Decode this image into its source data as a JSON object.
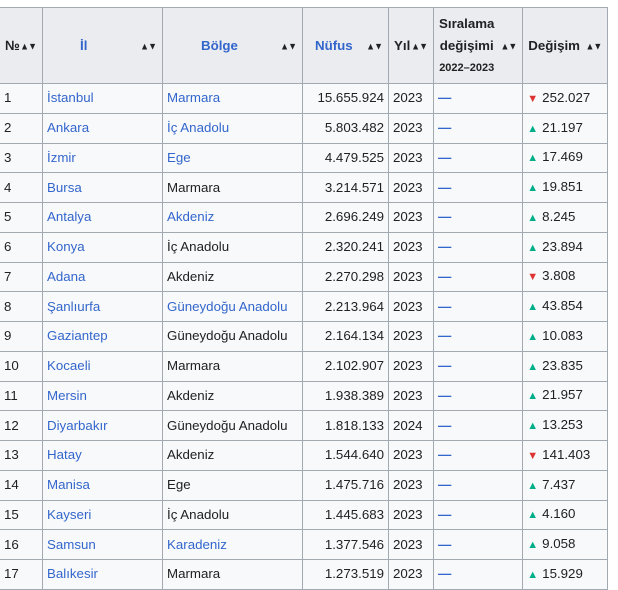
{
  "headers": {
    "rank": "№",
    "il": "İl",
    "bolge": "Bölge",
    "nufus": "Nüfus",
    "yil": "Yıl",
    "siralama_line1": "Sıralama",
    "siralama_line2": "değişimi",
    "siralama_years": "2022–2023",
    "degisim": "Değişim"
  },
  "rows": [
    {
      "rank": "1",
      "il": "İstanbul",
      "bolge": "Marmara",
      "bolge_link": true,
      "nufus": "15.655.924",
      "yil": "2023",
      "rank_change": "—",
      "dir": "down",
      "change": "252.027"
    },
    {
      "rank": "2",
      "il": "Ankara",
      "bolge": "İç Anadolu",
      "bolge_link": true,
      "nufus": "5.803.482",
      "yil": "2023",
      "rank_change": "—",
      "dir": "up",
      "change": "21.197"
    },
    {
      "rank": "3",
      "il": "İzmir",
      "bolge": "Ege",
      "bolge_link": true,
      "nufus": "4.479.525",
      "yil": "2023",
      "rank_change": "—",
      "dir": "up",
      "change": "17.469"
    },
    {
      "rank": "4",
      "il": "Bursa",
      "bolge": "Marmara",
      "bolge_link": false,
      "nufus": "3.214.571",
      "yil": "2023",
      "rank_change": "—",
      "dir": "up",
      "change": "19.851"
    },
    {
      "rank": "5",
      "il": "Antalya",
      "bolge": "Akdeniz",
      "bolge_link": true,
      "nufus": "2.696.249",
      "yil": "2023",
      "rank_change": "—",
      "dir": "up",
      "change": "8.245"
    },
    {
      "rank": "6",
      "il": "Konya",
      "bolge": "İç Anadolu",
      "bolge_link": false,
      "nufus": "2.320.241",
      "yil": "2023",
      "rank_change": "—",
      "dir": "up",
      "change": "23.894"
    },
    {
      "rank": "7",
      "il": "Adana",
      "bolge": "Akdeniz",
      "bolge_link": false,
      "nufus": "2.270.298",
      "yil": "2023",
      "rank_change": "—",
      "dir": "down",
      "change": "3.808"
    },
    {
      "rank": "8",
      "il": "Şanlıurfa",
      "bolge": "Güneydoğu Anadolu",
      "bolge_link": true,
      "nufus": "2.213.964",
      "yil": "2023",
      "rank_change": "—",
      "dir": "up",
      "change": "43.854"
    },
    {
      "rank": "9",
      "il": "Gaziantep",
      "bolge": "Güneydoğu Anadolu",
      "bolge_link": false,
      "nufus": "2.164.134",
      "yil": "2023",
      "rank_change": "—",
      "dir": "up",
      "change": "10.083"
    },
    {
      "rank": "10",
      "il": "Kocaeli",
      "bolge": "Marmara",
      "bolge_link": false,
      "nufus": "2.102.907",
      "yil": "2023",
      "rank_change": "—",
      "dir": "up",
      "change": "23.835"
    },
    {
      "rank": "11",
      "il": "Mersin",
      "bolge": "Akdeniz",
      "bolge_link": false,
      "nufus": "1.938.389",
      "yil": "2023",
      "rank_change": "—",
      "dir": "up",
      "change": "21.957"
    },
    {
      "rank": "12",
      "il": "Diyarbakır",
      "bolge": "Güneydoğu Anadolu",
      "bolge_link": false,
      "nufus": "1.818.133",
      "yil": "2024",
      "rank_change": "—",
      "dir": "up",
      "change": "13.253"
    },
    {
      "rank": "13",
      "il": "Hatay",
      "bolge": "Akdeniz",
      "bolge_link": false,
      "nufus": "1.544.640",
      "yil": "2023",
      "rank_change": "—",
      "dir": "down",
      "change": "141.403"
    },
    {
      "rank": "14",
      "il": "Manisa",
      "bolge": "Ege",
      "bolge_link": false,
      "nufus": "1.475.716",
      "yil": "2023",
      "rank_change": "—",
      "dir": "up",
      "change": "7.437"
    },
    {
      "rank": "15",
      "il": "Kayseri",
      "bolge": "İç Anadolu",
      "bolge_link": false,
      "nufus": "1.445.683",
      "yil": "2023",
      "rank_change": "—",
      "dir": "up",
      "change": "4.160"
    },
    {
      "rank": "16",
      "il": "Samsun",
      "bolge": "Karadeniz",
      "bolge_link": true,
      "nufus": "1.377.546",
      "yil": "2023",
      "rank_change": "—",
      "dir": "up",
      "change": "9.058"
    },
    {
      "rank": "17",
      "il": "Balıkesir",
      "bolge": "Marmara",
      "bolge_link": false,
      "nufus": "1.273.519",
      "yil": "2023",
      "rank_change": "—",
      "dir": "up",
      "change": "15.929"
    }
  ],
  "icons": {
    "sort": "sort-both-icon",
    "up": "up-triangle-icon",
    "down": "down-triangle-icon",
    "no_change": "dash-no-change-icon"
  },
  "colors": {
    "link": "#3366cc",
    "up": "#00af89",
    "down": "#dd3333",
    "header_bg": "#eaecf0",
    "cell_bg": "#f8f9fa",
    "border": "#a2a9b1"
  }
}
